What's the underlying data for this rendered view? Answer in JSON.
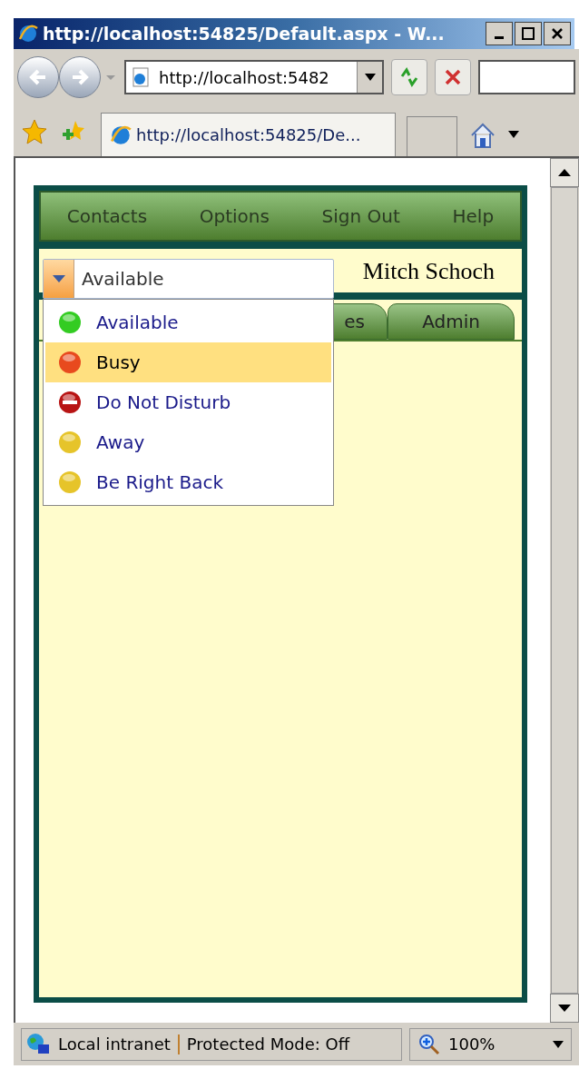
{
  "window": {
    "title": "http://localhost:54825/Default.aspx - W..."
  },
  "toolbar": {
    "address": "http://localhost:5482"
  },
  "browser_tabs": [
    {
      "label": "http://localhost:54825/De..."
    }
  ],
  "menu": [
    "Contacts",
    "Options",
    "Sign Out",
    "Help"
  ],
  "user_name": "Mitch Schoch",
  "status_select": {
    "value": "Available",
    "expanded": true,
    "options": [
      {
        "label": "Available",
        "kind": "dot",
        "color": "#33cc22",
        "highlighted": false
      },
      {
        "label": "Busy",
        "kind": "dot",
        "color": "#e84a1e",
        "highlighted": true
      },
      {
        "label": "Do Not Disturb",
        "kind": "blocked",
        "color": "#b81414",
        "highlighted": false
      },
      {
        "label": "Away",
        "kind": "dot",
        "color": "#e6c42a",
        "highlighted": false
      },
      {
        "label": "Be Right Back",
        "kind": "dot",
        "color": "#e6c42a",
        "highlighted": false
      }
    ]
  },
  "tabs": [
    {
      "label": "es"
    },
    {
      "label": "Admin"
    }
  ],
  "status_bar": {
    "zone": "Local intranet",
    "protected_mode": "Protected Mode: Off",
    "zoom": "100%"
  }
}
